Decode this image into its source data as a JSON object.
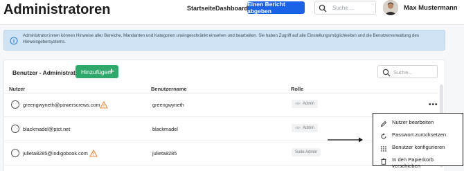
{
  "header": {
    "title": "Administratoren",
    "nav": [
      "Startseite",
      "Dashboard"
    ],
    "cta_label": "Einen Bericht abgeben",
    "search_placeholder": "Suche ...",
    "user_name": "Max Mustermann"
  },
  "info_banner": {
    "text": "Administrator:innen können Hinweise aller Bereiche, Mandanten und Kategorien uneingeschränkt einsehen und bearbeiten. Sie haben Zugriff auf alle Einstellungsmöglichkeiten und die Benutzerverwaltung des Hinweisgebersystems."
  },
  "panel": {
    "title": "Benutzer - Administratoren",
    "add_label": "Hinzufügen",
    "search_placeholder": "Suche..."
  },
  "table": {
    "columns": [
      "Nutzer",
      "Benutzername",
      "Rolle"
    ],
    "rows": [
      {
        "email": "greengwyneth@powerscrews.com",
        "warning": true,
        "username": "greengwyneth",
        "role": "Admin",
        "role_icon": "eye-icon"
      },
      {
        "email": "blackmadel@ptct.net",
        "warning": false,
        "username": "blackmadel",
        "role": "Admin",
        "role_icon": "eye-icon"
      },
      {
        "email": "julieta8285@indigobook.com",
        "warning": true,
        "username": "julieta8285",
        "role": "Suite Admin",
        "role_icon": ""
      }
    ]
  },
  "context_menu": {
    "items": [
      {
        "label": "Nutzer bearbeiten",
        "icon": "pencil-icon"
      },
      {
        "label": "Passwort zurücksetzen",
        "icon": "refresh-icon"
      },
      {
        "label": "Benutzer konfigurieren",
        "icon": "grid-icon"
      },
      {
        "label": "In den Papierkorb verschieben",
        "icon": "trash-icon"
      }
    ]
  },
  "colors": {
    "primary": "#1a63e6",
    "success": "#2fa86b",
    "warning": "#e8893a",
    "info_bg": "#cfe3f5"
  }
}
